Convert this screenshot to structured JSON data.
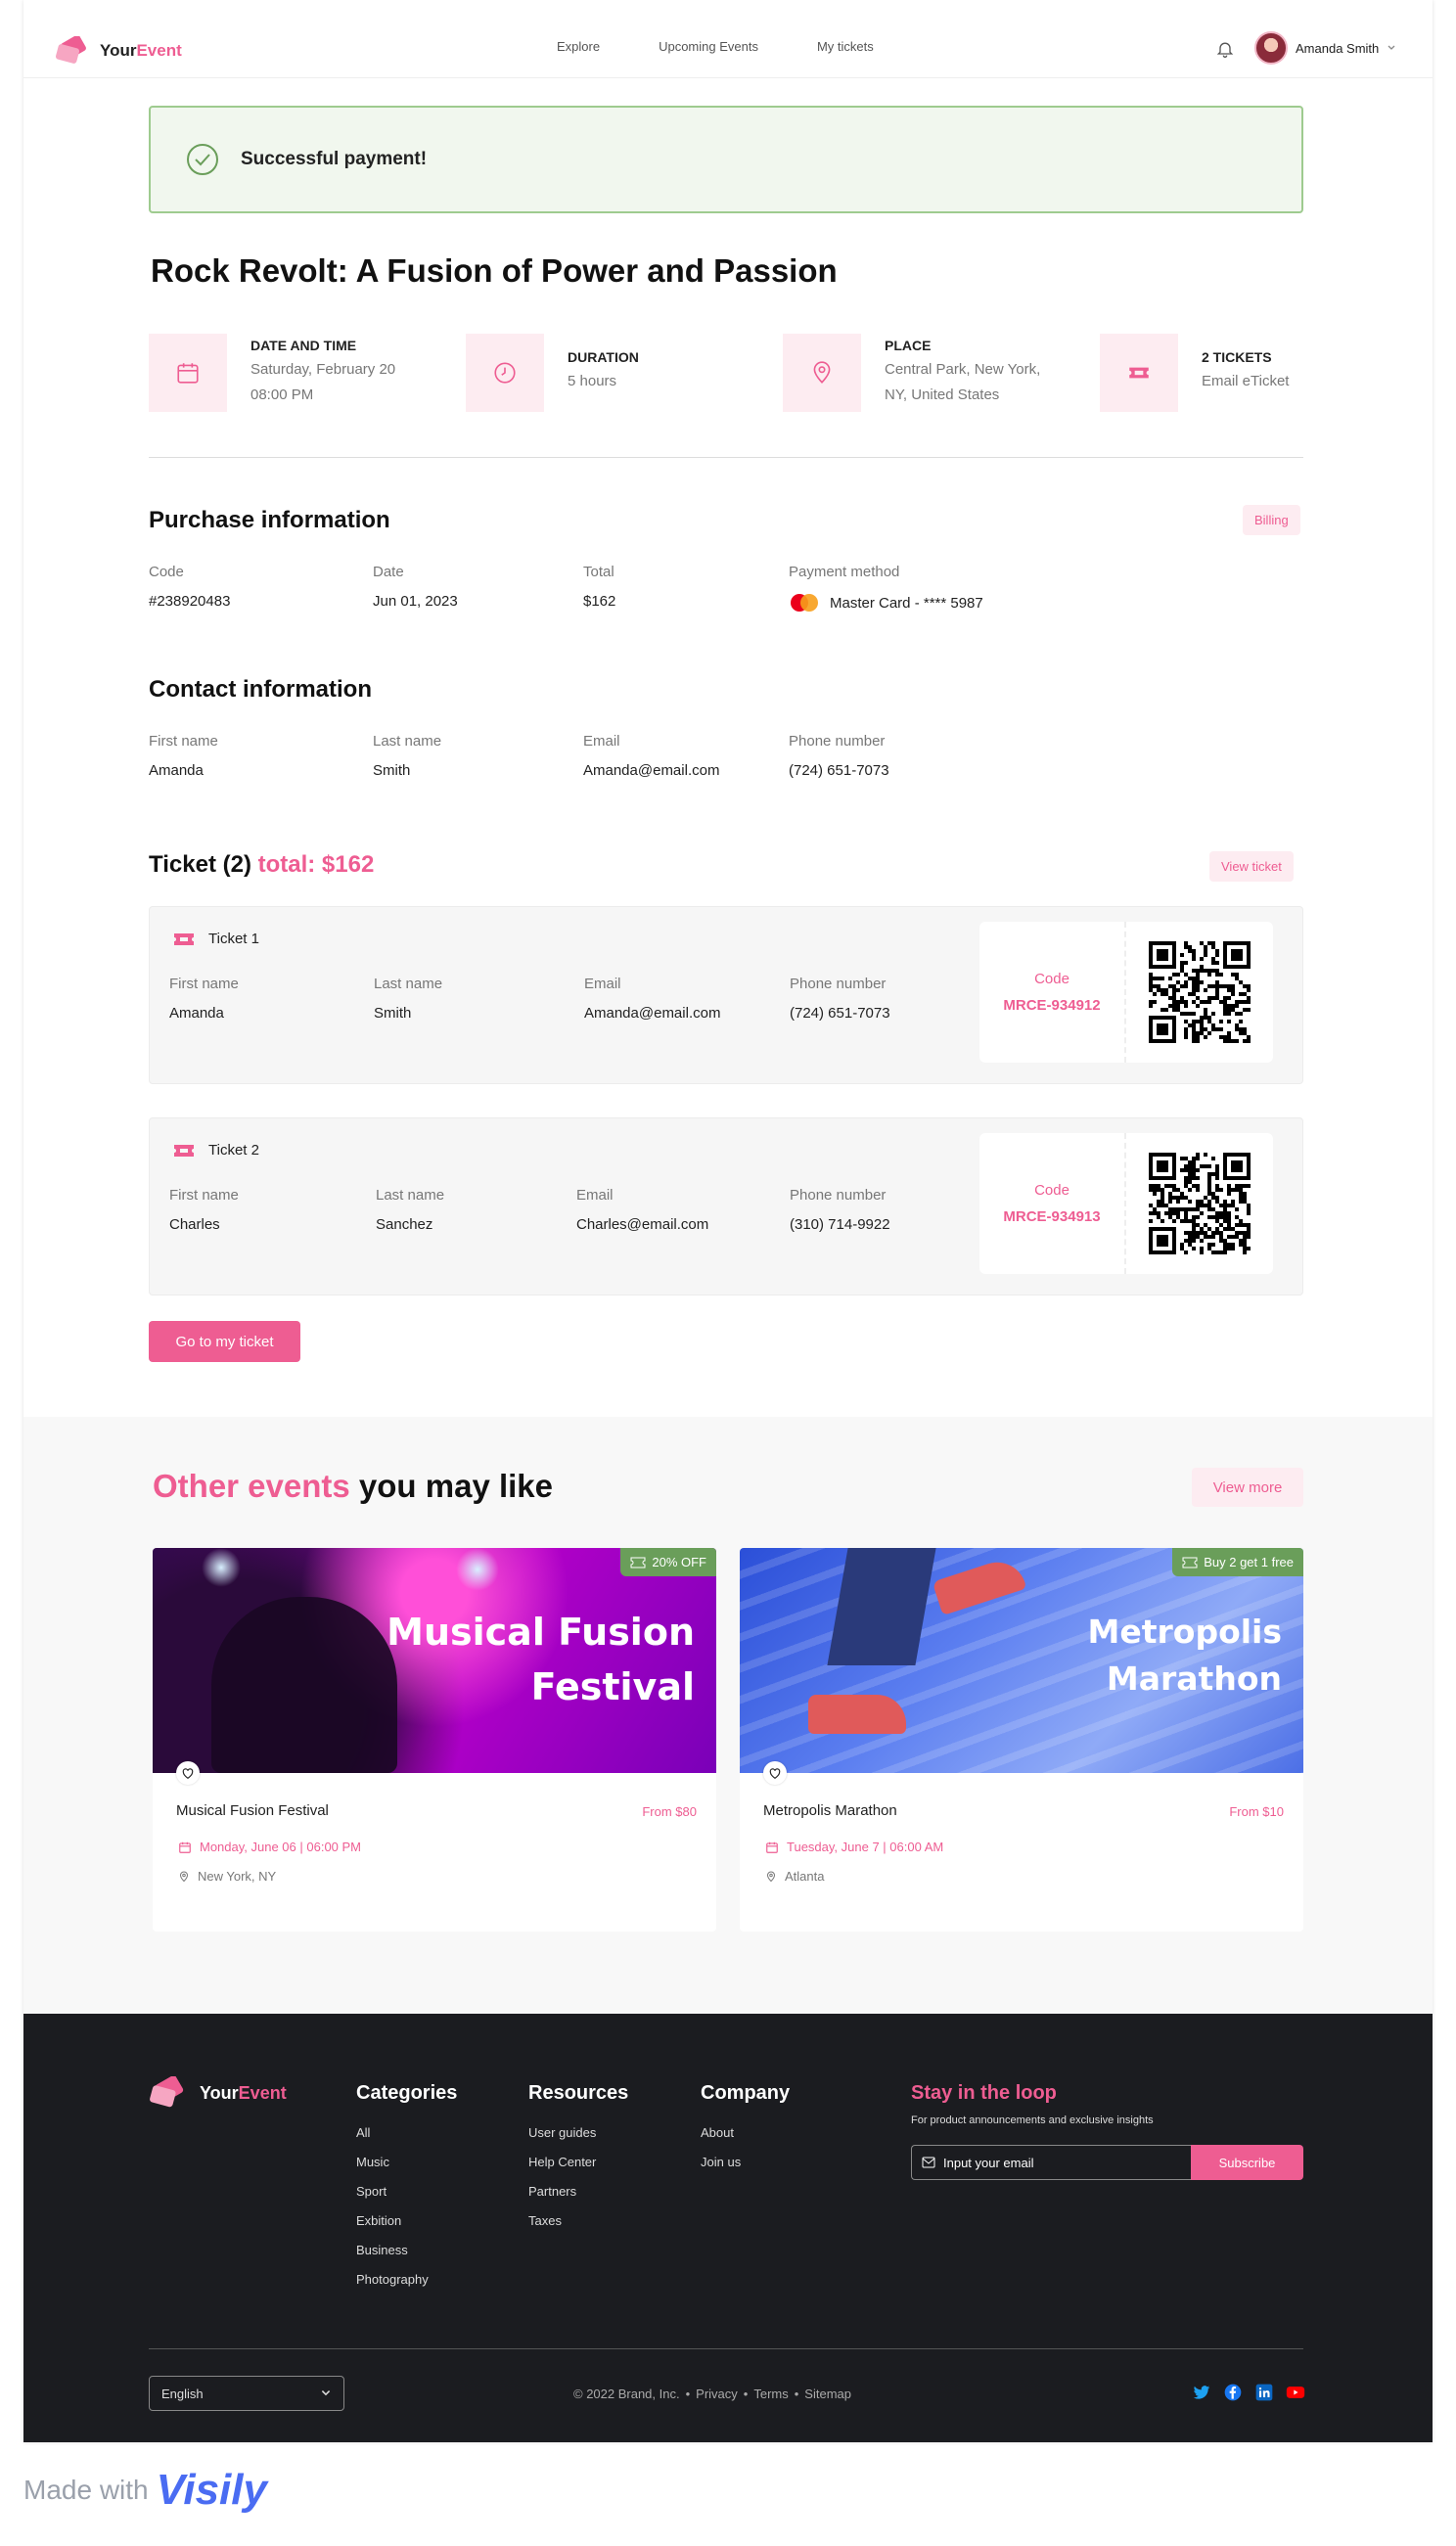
{
  "brand": {
    "name_part1": "Your",
    "name_part2": "Event"
  },
  "nav": {
    "links": [
      "Explore",
      "Upcoming Events",
      "My tickets"
    ],
    "user_name": "Amanda Smith"
  },
  "alert": {
    "text": "Successful payment!"
  },
  "event": {
    "title": "Rock Revolt: A Fusion of Power and Passion",
    "date_label": "DATE AND TIME",
    "date_value_1": "Saturday, February 20",
    "date_value_2": "08:00 PM",
    "duration_label": "DURATION",
    "duration_value": "5 hours",
    "place_label": "PLACE",
    "place_value_1": "Central Park, New York,",
    "place_value_2": "NY, United States",
    "tickets_label": "2 TICKETS",
    "tickets_value": "Email eTicket"
  },
  "purchase": {
    "title": "Purchase information",
    "billing": "Billing",
    "code_label": "Code",
    "code": "#238920483",
    "date_label": "Date",
    "date": "Jun 01, 2023",
    "total_label": "Total",
    "total": "$162",
    "payment_label": "Payment method",
    "payment": "Master Card - **** 5987"
  },
  "contact": {
    "title": "Contact information",
    "first_label": "First name",
    "first": "Amanda",
    "last_label": "Last name",
    "last": "Smith",
    "email_label": "Email",
    "email": "Amanda@email.com",
    "phone_label": "Phone number",
    "phone": "(724) 651-7073"
  },
  "tickets_section": {
    "title": "Ticket (2)",
    "total": "total: $162",
    "view_ticket": "View ticket"
  },
  "tickets": [
    {
      "label": "Ticket 1",
      "first_label": "First name",
      "first": "Amanda",
      "last_label": "Last name",
      "last": "Smith",
      "email_label": "Email",
      "email": "Amanda@email.com",
      "phone_label": "Phone number",
      "phone": "(724) 651-7073",
      "code_label": "Code",
      "code": "MRCE-934912"
    },
    {
      "label": "Ticket 2",
      "first_label": "First name",
      "first": "Charles",
      "last_label": "Last name",
      "last": "Sanchez",
      "email_label": "Email",
      "email": "Charles@email.com",
      "phone_label": "Phone number",
      "phone": "(310) 714-9922",
      "code_label": "Code",
      "code": "MRCE-934913"
    }
  ],
  "go_to_ticket": "Go to my ticket",
  "other": {
    "title_hl": "Other events",
    "title_rest": " you may like",
    "view_more": "View more",
    "cards": [
      {
        "badge": "20% OFF",
        "img_title_1": "Musical Fusion",
        "img_title_2": "Festival",
        "name": "Musical Fusion Festival",
        "price": "From $80",
        "date": "Monday, June 06 | 06:00 PM",
        "location": "New York, NY"
      },
      {
        "badge": "Buy 2 get 1 free",
        "img_title_1": "Metropolis",
        "img_title_2": "Marathon",
        "name": "Metropolis Marathon",
        "price": "From $10",
        "date": "Tuesday, June 7 | 06:00 AM",
        "location": "Atlanta"
      }
    ]
  },
  "footer": {
    "categories": {
      "title": "Categories",
      "items": [
        "All",
        "Music",
        "Sport",
        "Exbition",
        "Business",
        "Photography"
      ]
    },
    "resources": {
      "title": "Resources",
      "items": [
        "User guides",
        "Help Center",
        "Partners",
        "Taxes"
      ]
    },
    "company": {
      "title": "Company",
      "items": [
        "About",
        "Join us"
      ]
    },
    "stay": {
      "title": "Stay in the loop",
      "subtitle": "For product announcements and exclusive insights",
      "placeholder": "Input your email",
      "subscribe": "Subscribe"
    },
    "language": "English",
    "copyright": "© 2022 Brand, Inc.",
    "links": [
      "Privacy",
      "Terms",
      "Sitemap"
    ]
  },
  "made_with": {
    "text": "Made with",
    "brand": "Visily"
  },
  "colors": {
    "accent": "#ee5d92",
    "success": "#6a9e5a",
    "footer_bg": "#1b1c20"
  }
}
